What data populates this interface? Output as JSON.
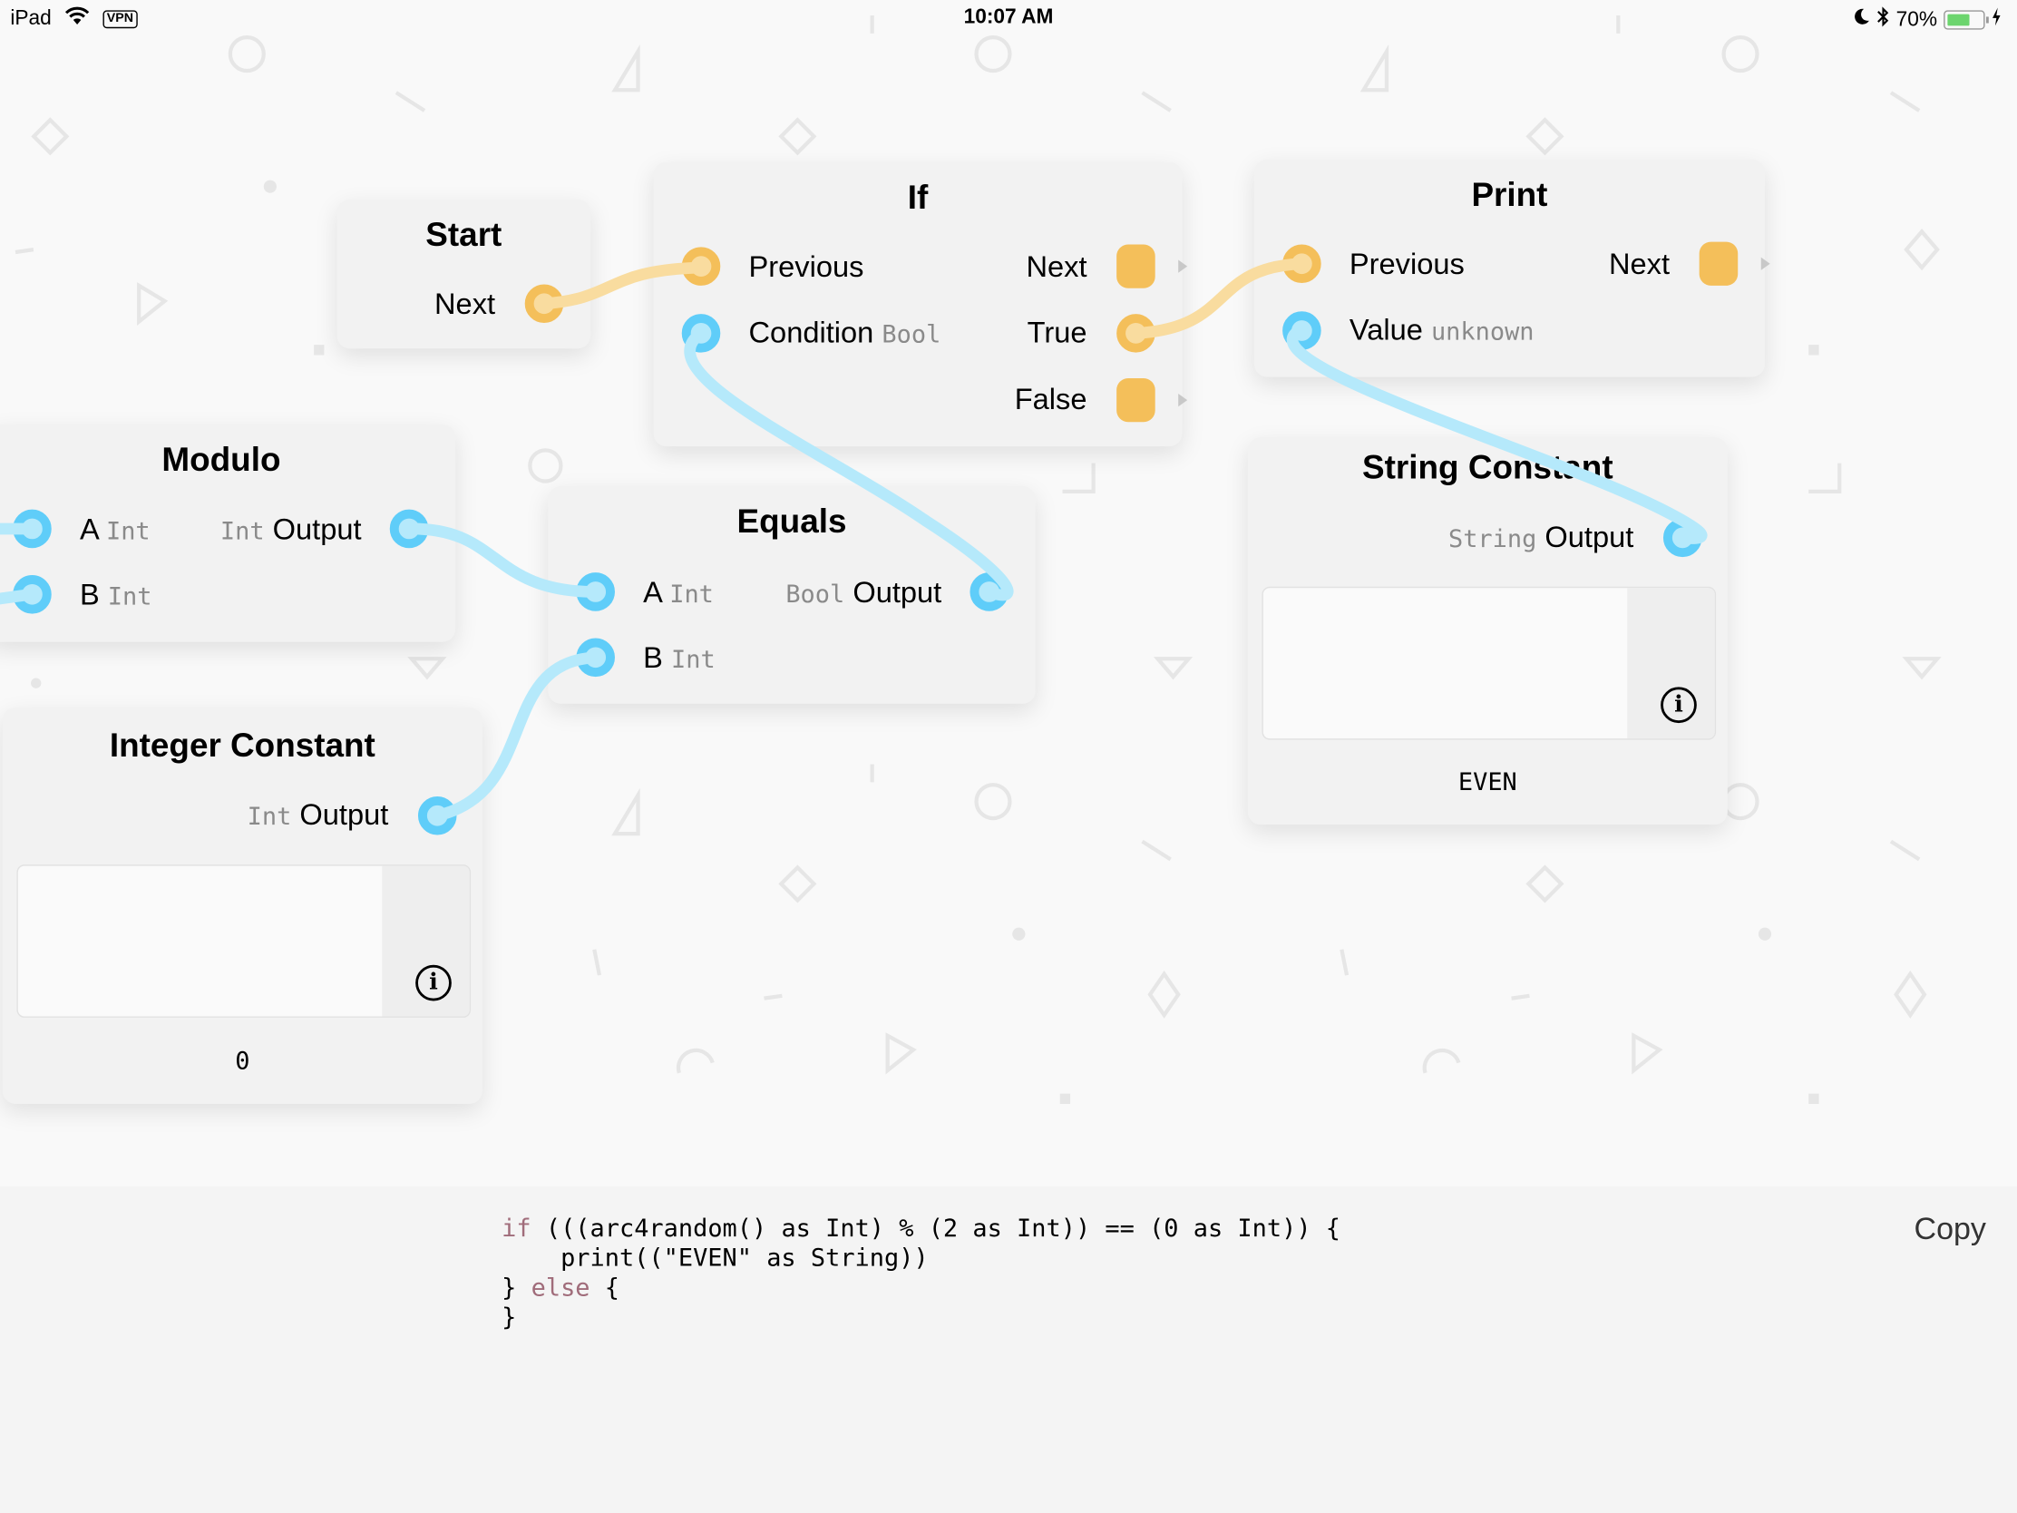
{
  "status_bar": {
    "device": "iPad",
    "vpn_label": "VPN",
    "time": "10:07 AM",
    "battery_percent": "70%",
    "battery_level": 0.7
  },
  "colors": {
    "flow_port": "#f4bf5a",
    "flow_wire": "#f9dc9f",
    "data_port": "#5fcdf9",
    "data_wire": "#b5e9fb"
  },
  "nodes": {
    "start": {
      "title": "Start",
      "next": "Next"
    },
    "if": {
      "title": "If",
      "previous": "Previous",
      "condition": "Condition",
      "condition_type": "Bool",
      "next": "Next",
      "true_label": "True",
      "false_label": "False"
    },
    "print": {
      "title": "Print",
      "previous": "Previous",
      "next": "Next",
      "value": "Value",
      "value_type": "unknown"
    },
    "modulo": {
      "title": "Modulo",
      "a": "A",
      "a_type": "Int",
      "b": "B",
      "b_type": "Int",
      "output": "Output",
      "output_type": "Int"
    },
    "equals": {
      "title": "Equals",
      "a": "A",
      "a_type": "Int",
      "b": "B",
      "b_type": "Int",
      "output": "Output",
      "output_type": "Bool"
    },
    "integer_constant": {
      "title": "Integer Constant",
      "output": "Output",
      "output_type": "Int",
      "value": "0"
    },
    "string_constant": {
      "title": "String Constant",
      "output": "Output",
      "output_type": "String",
      "value": "EVEN"
    }
  },
  "code_panel": {
    "lines": [
      {
        "kw": "if",
        "rest": " (((arc4random() as Int) % (2 as Int)) == (0 as Int)) {"
      },
      {
        "kw": "",
        "rest": "    print((\"EVEN\" as String))"
      },
      {
        "pre": "} ",
        "kw": "else",
        "rest": " {"
      },
      {
        "kw": "",
        "rest": "}"
      }
    ],
    "copy_label": "Copy"
  }
}
